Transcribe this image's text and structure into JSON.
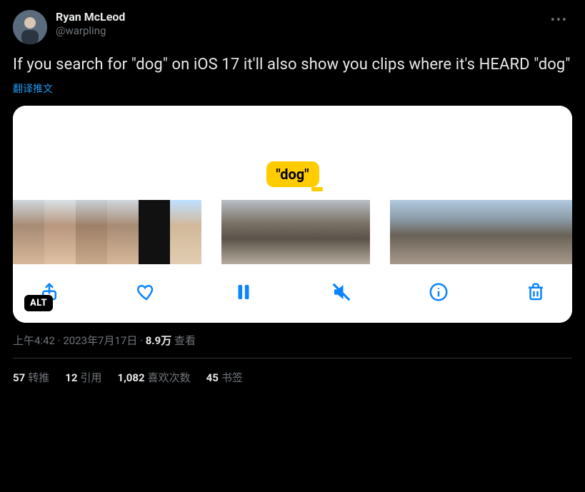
{
  "author": {
    "display_name": "Ryan McLeod",
    "handle": "@warpling"
  },
  "tweet_text": "If you search for \"dog\" on iOS 17 it'll also show you clips where it's HEARD \"dog\"",
  "translate_label": "翻译推文",
  "media": {
    "caption_pill": "\"dog\"",
    "alt_badge": "ALT"
  },
  "meta": {
    "time": "上午4:42",
    "date": "2023年7月17日",
    "separator": " · ",
    "views_count": "8.9万",
    "views_label": " 查看"
  },
  "stats": {
    "retweets": {
      "count": "57",
      "label": "转推"
    },
    "quotes": {
      "count": "12",
      "label": "引用"
    },
    "likes": {
      "count": "1,082",
      "label": "喜欢次数"
    },
    "bookmarks": {
      "count": "45",
      "label": "书签"
    }
  }
}
